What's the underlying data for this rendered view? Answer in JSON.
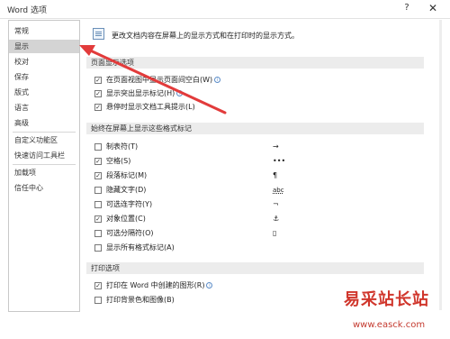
{
  "window": {
    "title": "Word 选项",
    "help": "?",
    "close": "✕"
  },
  "sidebar": {
    "items": [
      {
        "label": "常规"
      },
      {
        "label": "显示"
      },
      {
        "label": "校对"
      },
      {
        "label": "保存"
      },
      {
        "label": "版式"
      },
      {
        "label": "语言"
      },
      {
        "label": "高级"
      },
      {
        "label": "自定义功能区"
      },
      {
        "label": "快速访问工具栏"
      },
      {
        "label": "加载项"
      },
      {
        "label": "信任中心"
      }
    ],
    "active": "显示"
  },
  "main": {
    "description": "更改文档内容在屏幕上的显示方式和在打印时的显示方式。",
    "sections": [
      {
        "title": "页面显示选项",
        "options": [
          {
            "label": "在页面视图中显示页面间空白(W)",
            "checked": true,
            "info": true
          },
          {
            "label": "显示突出显示标记(H)",
            "checked": true,
            "info": true
          },
          {
            "label": "悬停时显示文档工具提示(L)",
            "checked": true
          }
        ]
      },
      {
        "title": "始终在屏幕上显示这些格式标记",
        "options": [
          {
            "label": "制表符(T)",
            "checked": false,
            "symbol": "→"
          },
          {
            "label": "空格(S)",
            "checked": true,
            "symbol": "•••"
          },
          {
            "label": "段落标记(M)",
            "checked": true,
            "symbol": "¶"
          },
          {
            "label": "隐藏文字(D)",
            "checked": false,
            "symbol": "abc"
          },
          {
            "label": "可选连字符(Y)",
            "checked": false,
            "symbol": "¬"
          },
          {
            "label": "对象位置(C)",
            "checked": true,
            "symbol": "⚓"
          },
          {
            "label": "可选分隔符(O)",
            "checked": false,
            "symbol": "▯"
          },
          {
            "label": "显示所有格式标记(A)",
            "checked": false
          }
        ]
      },
      {
        "title": "打印选项",
        "options": [
          {
            "label": "打印在 Word 中创建的图形(R)",
            "checked": true,
            "info": true
          },
          {
            "label": "打印背景色和图像(B)",
            "checked": false
          }
        ]
      }
    ]
  },
  "watermark": {
    "title": "易采站长站",
    "url": "www.easck.com"
  },
  "colors": {
    "arrow": "#e23b3b",
    "active_bg": "#d4d4d4",
    "section_bg": "#ececec",
    "watermark": "#d0362c"
  }
}
